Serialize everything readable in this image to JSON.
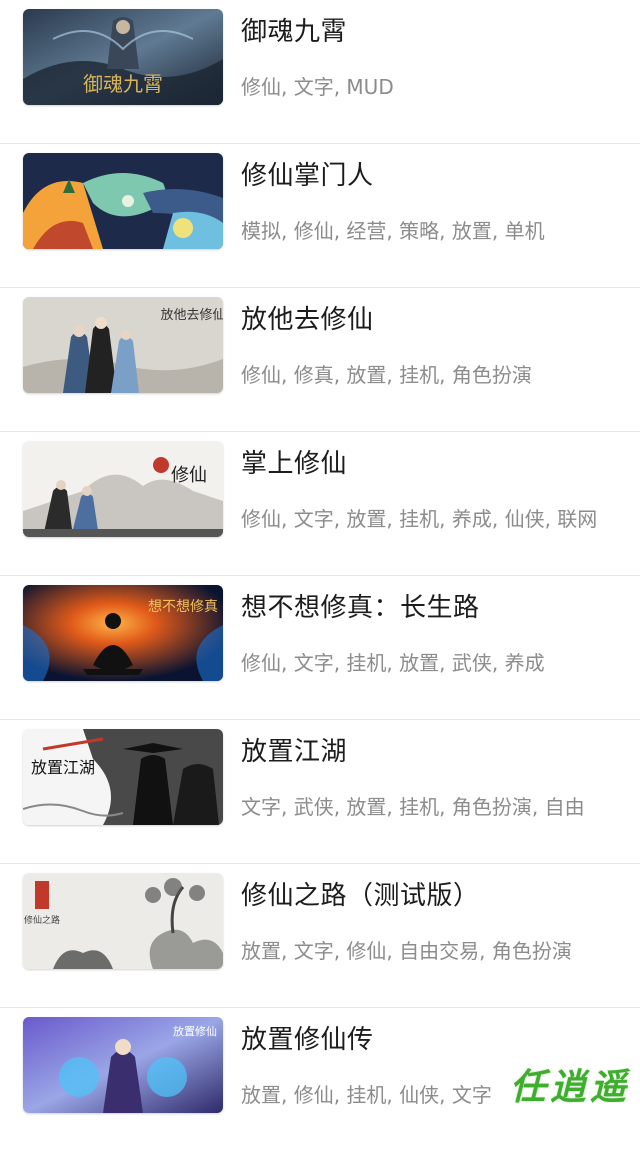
{
  "games": [
    {
      "title": "御魂九霄",
      "tags": "修仙, 文字, MUD",
      "thumb_caption": "御魂九霄",
      "thumb_icon": "cover-yuhun"
    },
    {
      "title": "修仙掌门人",
      "tags": "模拟, 修仙, 经营, 策略, 放置, 单机",
      "thumb_caption": "",
      "thumb_icon": "cover-map"
    },
    {
      "title": "放他去修仙",
      "tags": "修仙, 修真, 放置, 挂机, 角色扮演",
      "thumb_caption": "放他去修仙",
      "thumb_icon": "cover-ink-characters"
    },
    {
      "title": "掌上修仙",
      "tags": "修仙, 文字, 放置, 挂机, 养成, 仙侠, 联网",
      "thumb_caption": "修仙",
      "thumb_icon": "cover-ink-landscape"
    },
    {
      "title": "想不想修真：长生路",
      "tags": "修仙, 文字, 挂机, 放置, 武侠, 养成",
      "thumb_caption": "想不想修真",
      "thumb_icon": "cover-meditation"
    },
    {
      "title": "放置江湖",
      "tags": "文字, 武侠, 放置, 挂机, 角色扮演, 自由",
      "thumb_caption": "放置江湖",
      "thumb_icon": "cover-swordsman"
    },
    {
      "title": "修仙之路（测试版）",
      "tags": "放置, 文字, 修仙, 自由交易, 角色扮演",
      "thumb_caption": "修仙之路",
      "thumb_icon": "cover-pine-rock"
    },
    {
      "title": "放置修仙传",
      "tags": "放置, 修仙, 挂机, 仙侠, 文字",
      "thumb_caption": "放置修仙",
      "thumb_icon": "cover-cultivator"
    }
  ],
  "watermark": "任逍遥",
  "colors": {
    "title": "#1c1c1c",
    "tags": "#8c8c8c",
    "divider": "#e6e6e6",
    "watermark": "#3fae2f"
  }
}
